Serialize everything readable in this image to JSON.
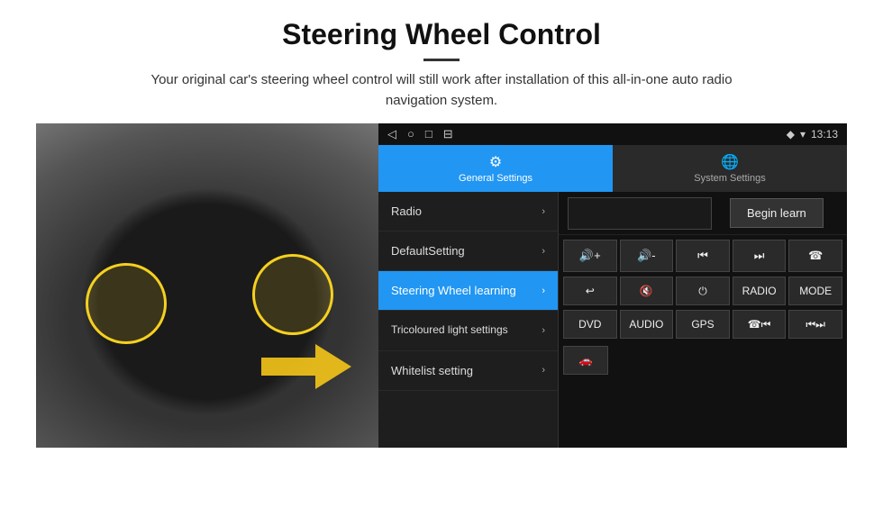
{
  "header": {
    "title": "Steering Wheel Control",
    "divider": true,
    "subtitle": "Your original car's steering wheel control will still work after installation of this all-in-one auto radio navigation system."
  },
  "statusbar": {
    "time": "13:13",
    "nav_icons": [
      "◁",
      "○",
      "□",
      "⊟"
    ],
    "right_icons": [
      "♦",
      "▾"
    ]
  },
  "tabs": [
    {
      "label": "General Settings",
      "icon": "⚙",
      "active": true
    },
    {
      "label": "System Settings",
      "icon": "🌐",
      "active": false
    }
  ],
  "menu_items": [
    {
      "label": "Radio",
      "active": false
    },
    {
      "label": "DefaultSetting",
      "active": false
    },
    {
      "label": "Steering Wheel learning",
      "active": true
    },
    {
      "label": "Tricoloured light settings",
      "active": false
    },
    {
      "label": "Whitelist setting",
      "active": false
    }
  ],
  "content": {
    "radio_placeholder": "",
    "begin_learn_label": "Begin learn",
    "buttons_row1": [
      "🔊+",
      "🔊-",
      "⏮",
      "⏭",
      "📞"
    ],
    "buttons_row1_unicode": [
      "◀◀+",
      "◀◀-",
      "⏮",
      "⏭",
      "☎"
    ],
    "buttons_row2": [
      "↩",
      "🔇",
      "⏻",
      "RADIO",
      "MODE"
    ],
    "buttons_row3": [
      "DVD",
      "AUDIO",
      "GPS",
      "☎⏮",
      "⏮⏭"
    ],
    "buttons_row4_icon": "🚗"
  }
}
